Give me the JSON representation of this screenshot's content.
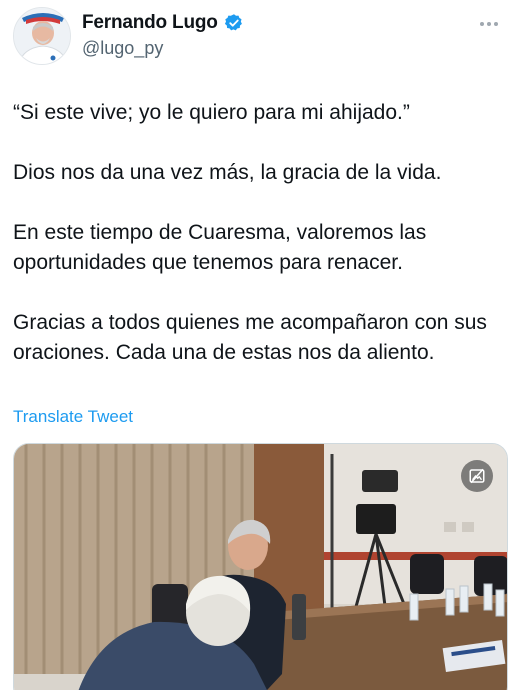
{
  "author": {
    "display_name": "Fernando Lugo",
    "handle": "@lugo_py",
    "avatar_icon": "profile-photo",
    "verified_icon": "verified-badge-icon",
    "verified_color": "#1d9bf0"
  },
  "menu": {
    "icon": "more-horizontal-icon"
  },
  "tweet": {
    "paragraphs": [
      "“Si este vive; yo le quiero para mi ahijado.”",
      "Dios nos da una vez más, la gracia de la vida.",
      "En este tiempo de Cuaresma, valoremos las oportunidades que tenemos para renacer.",
      "Gracias a todos quienes me acompañaron con sus oraciones. Cada una de estas nos da aliento."
    ],
    "translate_label": "Translate Tweet"
  },
  "media": {
    "type": "photo",
    "badge_icon": "no-image-icon"
  },
  "colors": {
    "text": "#0f1419",
    "secondary": "#536471",
    "link": "#1d9bf0"
  }
}
